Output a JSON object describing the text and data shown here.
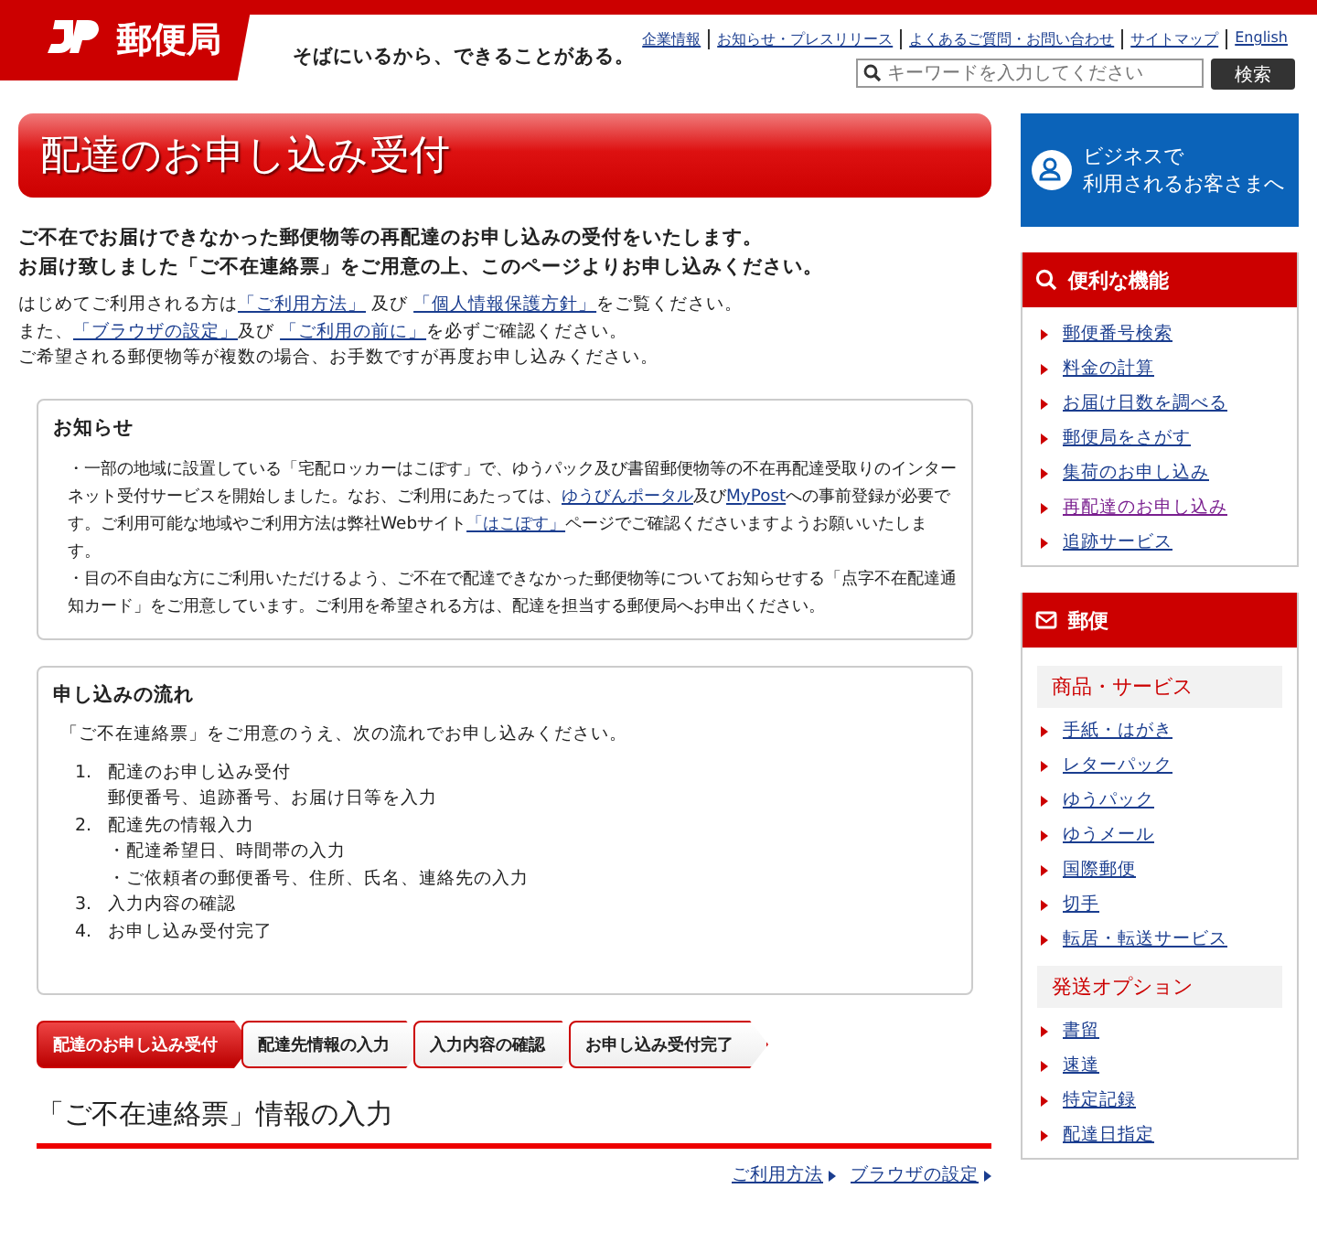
{
  "header": {
    "logo_text": "郵便局",
    "tagline": "そばにいるから、できることがある。",
    "links": [
      "企業情報",
      "お知らせ・プレスリリース",
      "よくあるご質問・お問い合わせ",
      "サイトマップ",
      "English"
    ],
    "search": {
      "placeholder": "キーワードを入力してください",
      "button": "検索"
    }
  },
  "page_title": "配達のお申し込み受付",
  "lead": [
    "ご不在でお届けできなかった郵便物等の再配達のお申し込みの受付をいたします。",
    "お届け致しました「ご不在連絡票」をご用意の上、このページよりお申し込みください。"
  ],
  "intro": [
    {
      "parts": [
        {
          "text": "はじめてご利用される方は"
        },
        {
          "text": "「ご利用方法」",
          "link": true
        },
        {
          "text": " 及び "
        },
        {
          "text": "「個人情報保護方針」",
          "link": true
        },
        {
          "text": "をご覧ください。"
        }
      ]
    },
    {
      "parts": [
        {
          "text": "また、"
        },
        {
          "text": "「ブラウザの設定」",
          "link": true
        },
        {
          "text": "及び "
        },
        {
          "text": "「ご利用の前に」",
          "link": true
        },
        {
          "text": "を必ずご確認ください。"
        }
      ]
    },
    {
      "parts": [
        {
          "text": "ご希望される郵便物等が複数の場合、お手数ですが再度お申し込みください。"
        }
      ]
    }
  ],
  "notice": {
    "title": "お知らせ",
    "paragraphs": [
      {
        "parts": [
          {
            "text": "・一部の地域に設置している「宅配ロッカーはこぽす」で、ゆうパック及び書留郵便物等の不在再配達受取りのインターネット受付サービスを開始しました。なお、ご利用にあたっては、"
          },
          {
            "text": "ゆうびんポータル",
            "link": true
          },
          {
            "text": "及び"
          },
          {
            "text": "MyPost",
            "link": true
          },
          {
            "text": "への事前登録が必要です。ご利用可能な地域やご利用方法は弊社Webサイト"
          },
          {
            "text": "「はこぽす」",
            "link": true
          },
          {
            "text": "ページでご確認くださいますようお願いいたします。"
          }
        ]
      },
      {
        "parts": [
          {
            "text": "・目の不自由な方にご利用いただけるよう、ご不在で配達できなかった郵便物等についてお知らせする「点字不在配達通知カード」をご用意しています。ご利用を希望される方は、配達を担当する郵便局へお申出ください。"
          }
        ]
      }
    ]
  },
  "flow": {
    "title": "申し込みの流れ",
    "intro": "「ご不在連絡票」をご用意のうえ、次の流れでお申し込みください。",
    "steps": [
      {
        "number": "1.",
        "label": "配達のお申し込み受付",
        "details": [
          "郵便番号、追跡番号、お届け日等を入力"
        ]
      },
      {
        "number": "2.",
        "label": "配達先の情報入力",
        "details": [
          "・配達希望日、時間帯の入力",
          "・ご依頼者の郵便番号、住所、氏名、連絡先の入力"
        ]
      },
      {
        "number": "3.",
        "label": "入力内容の確認"
      },
      {
        "number": "4.",
        "label": "お申し込み受付完了"
      }
    ]
  },
  "stepper": [
    {
      "label": "配達のお申し込み受付",
      "selected": true
    },
    {
      "label": "配達先情報の入力",
      "selected": false
    },
    {
      "label": "入力内容の確認",
      "selected": false
    },
    {
      "label": "お申し込み受付完了",
      "selected": false
    }
  ],
  "section_title": "「ご不在連絡票」情報の入力",
  "help_links": [
    "ご利用方法",
    "ブラウザの設定"
  ],
  "sidebar": {
    "business": {
      "line1": "ビジネスで",
      "line2": "利用されるお客さまへ"
    },
    "panels": [
      {
        "kind": "search",
        "title": "便利な機能",
        "groups": [
          {
            "items": [
              {
                "label": "郵便番号検索",
                "visited": false
              },
              {
                "label": "料金の計算",
                "visited": false
              },
              {
                "label": "お届け日数を調べる",
                "visited": false
              },
              {
                "label": "郵便局をさがす",
                "visited": false
              },
              {
                "label": "集荷のお申し込み",
                "visited": false
              },
              {
                "label": "再配達のお申し込み",
                "visited": true
              },
              {
                "label": "追跡サービス",
                "visited": false
              }
            ]
          }
        ]
      },
      {
        "kind": "mail",
        "title": "郵便",
        "groups": [
          {
            "heading": "商品・サービス",
            "items": [
              {
                "label": "手紙・はがき",
                "visited": false
              },
              {
                "label": "レターパック",
                "visited": false
              },
              {
                "label": "ゆうパック",
                "visited": false
              },
              {
                "label": "ゆうメール",
                "visited": false
              },
              {
                "label": "国際郵便",
                "visited": false
              },
              {
                "label": "切手",
                "visited": false
              },
              {
                "label": "転居・転送サービス",
                "visited": false
              }
            ]
          },
          {
            "heading": "発送オプション",
            "items": [
              {
                "label": "書留",
                "visited": false
              },
              {
                "label": "速達",
                "visited": false
              },
              {
                "label": "特定記録",
                "visited": false
              },
              {
                "label": "配達日指定",
                "visited": false
              }
            ]
          }
        ]
      }
    ]
  }
}
